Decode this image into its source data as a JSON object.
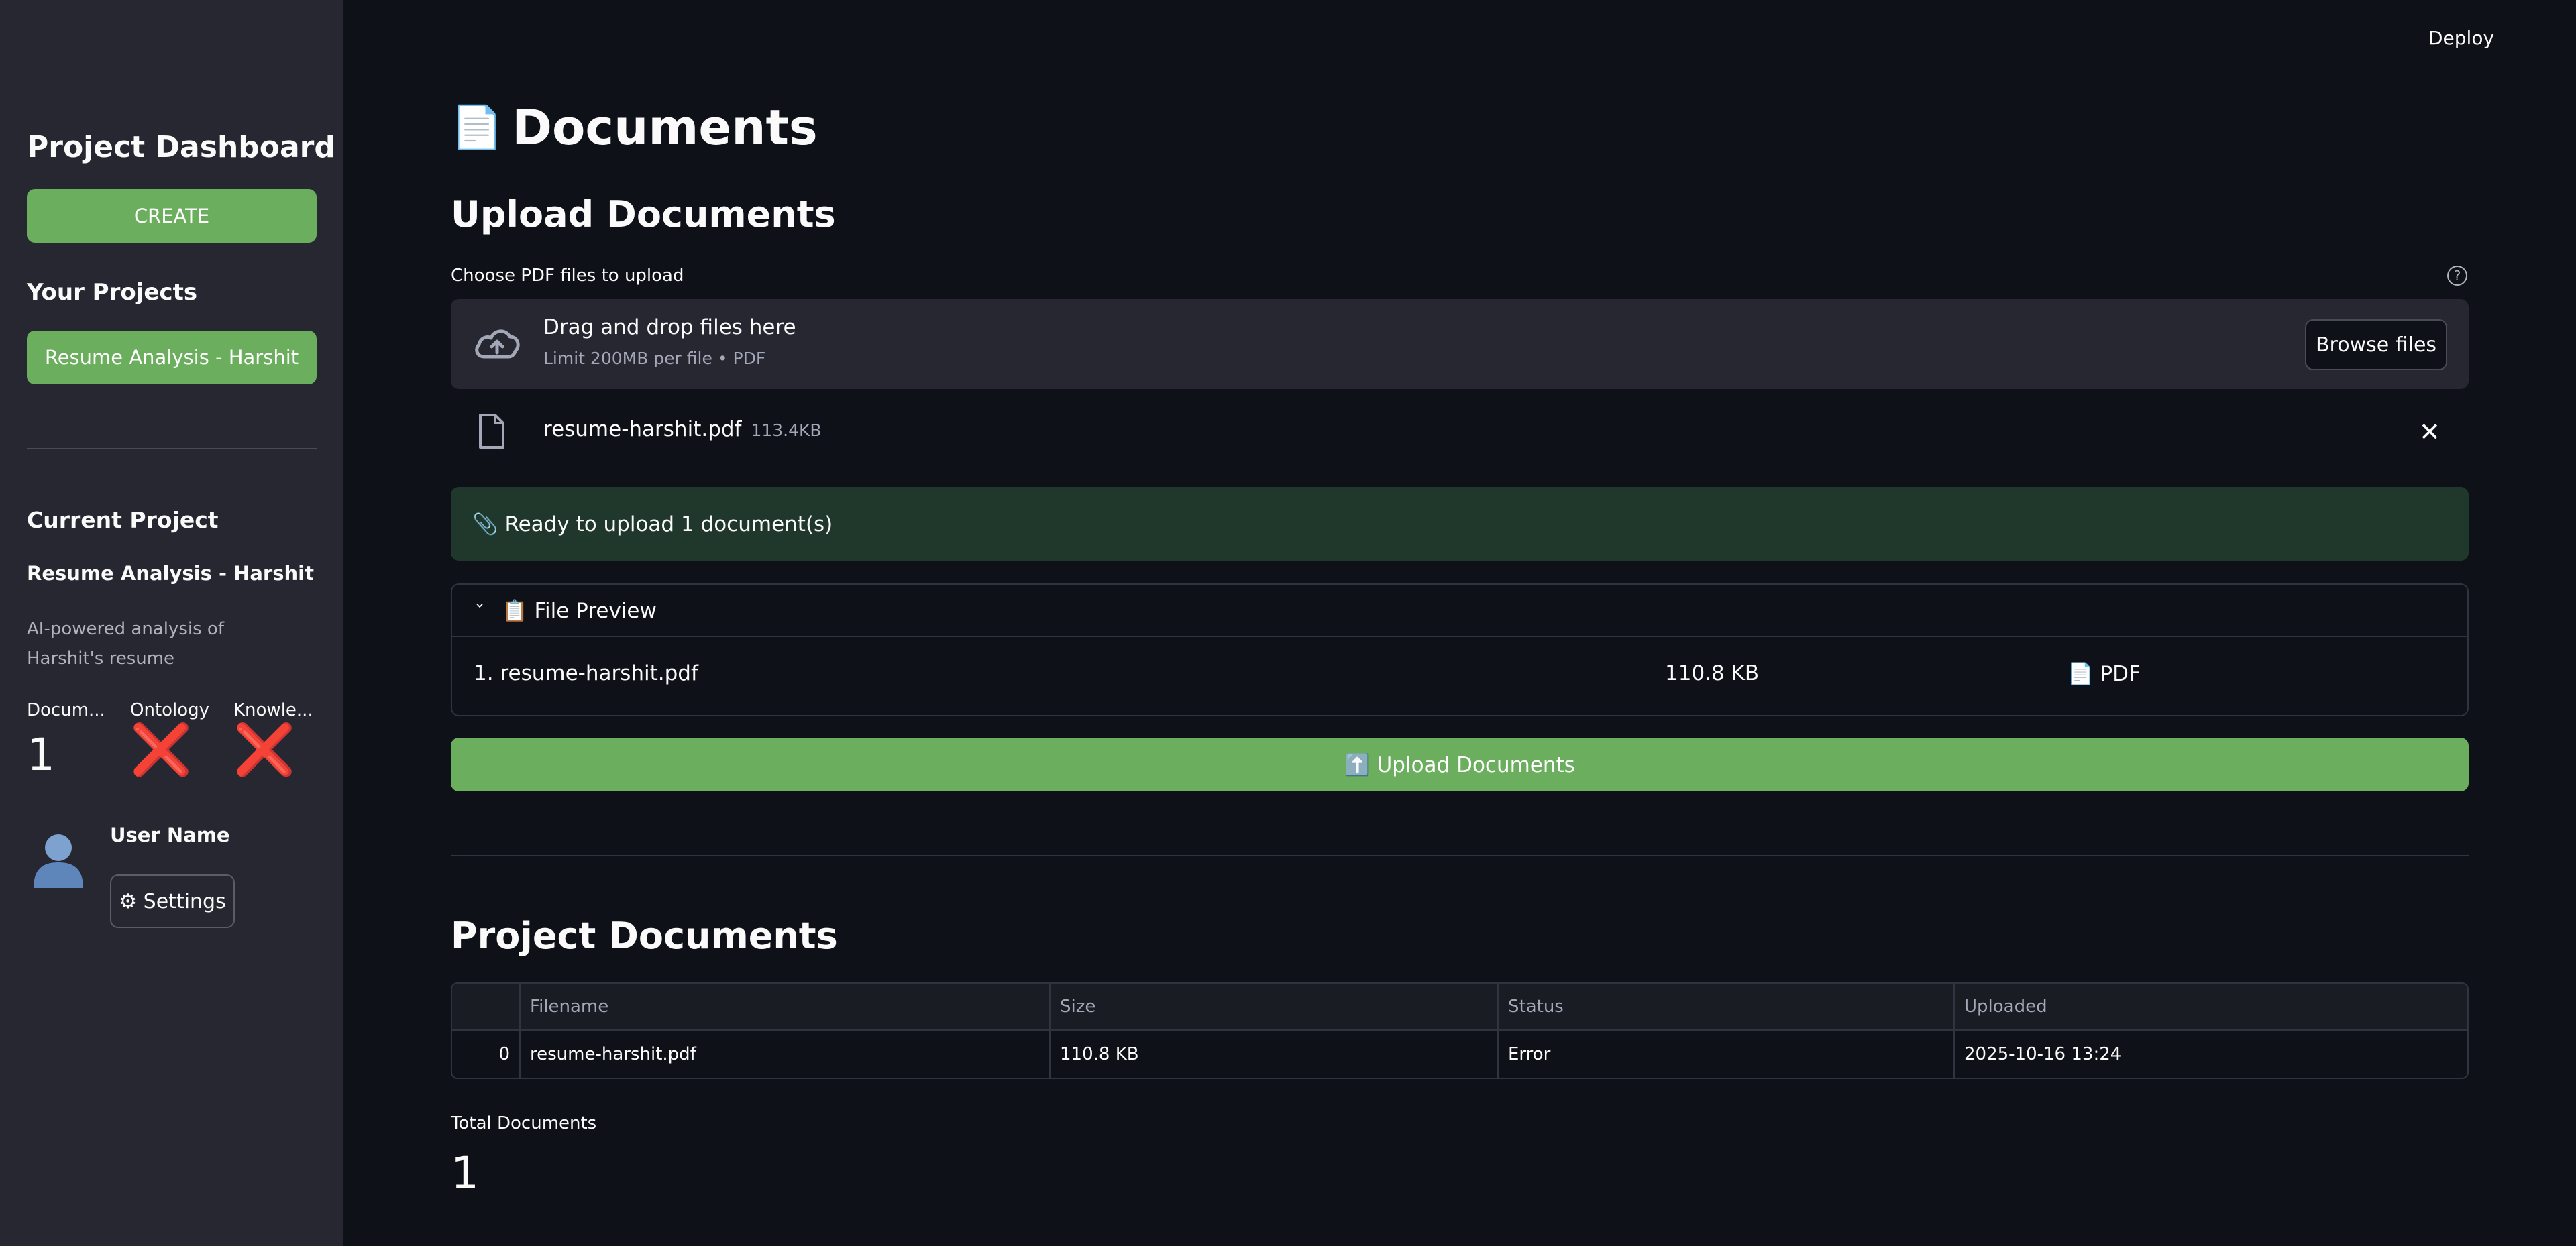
{
  "header": {
    "deploy_label": "Deploy"
  },
  "sidebar": {
    "title": "Project Dashboard",
    "create_label": "CREATE",
    "your_projects_heading": "Your Projects",
    "projects": [
      "Resume Analysis - Harshit"
    ],
    "current_project_heading": "Current Project",
    "current_project_name": "Resume Analysis - Harshit",
    "current_project_description": "AI-powered analysis of Harshit's resume",
    "metrics": [
      {
        "label": "Docum...",
        "value": "1"
      },
      {
        "label": "Ontology",
        "value": "❌"
      },
      {
        "label": "Knowle...",
        "value": "❌"
      }
    ],
    "user_name": "User Name",
    "settings_label": "⚙ Settings"
  },
  "main": {
    "page_title": "Documents",
    "page_title_icon": "📄",
    "upload_heading": "Upload Documents",
    "uploader_label": "Choose PDF files to upload",
    "help_icon": "?",
    "dropzone_title": "Drag and drop files here",
    "dropzone_subtitle": "Limit 200MB per file • PDF",
    "browse_label": "Browse files",
    "uploaded_file": {
      "name": "resume-harshit.pdf",
      "size": "113.4KB"
    },
    "ready_message": "📎 Ready to upload 1 document(s)",
    "preview": {
      "header": "📋 File Preview",
      "rows": [
        {
          "name": "1. resume-harshit.pdf",
          "size": "110.8 KB",
          "type": "📄 PDF"
        }
      ]
    },
    "upload_button_label": "⬆️ Upload Documents",
    "project_docs_heading": "Project Documents",
    "table": {
      "columns": [
        "",
        "Filename",
        "Size",
        "Status",
        "Uploaded"
      ],
      "rows": [
        [
          "0",
          "resume-harshit.pdf",
          "110.8 KB",
          "Error",
          "2025-10-16 13:24"
        ]
      ]
    },
    "total_label": "Total Documents",
    "total_value": "1"
  },
  "colors": {
    "background": "#0e1117",
    "sidebar": "#262730",
    "accent_green": "#6aae5e",
    "success_bg": "#20382b",
    "error_red": "#e0263a"
  }
}
